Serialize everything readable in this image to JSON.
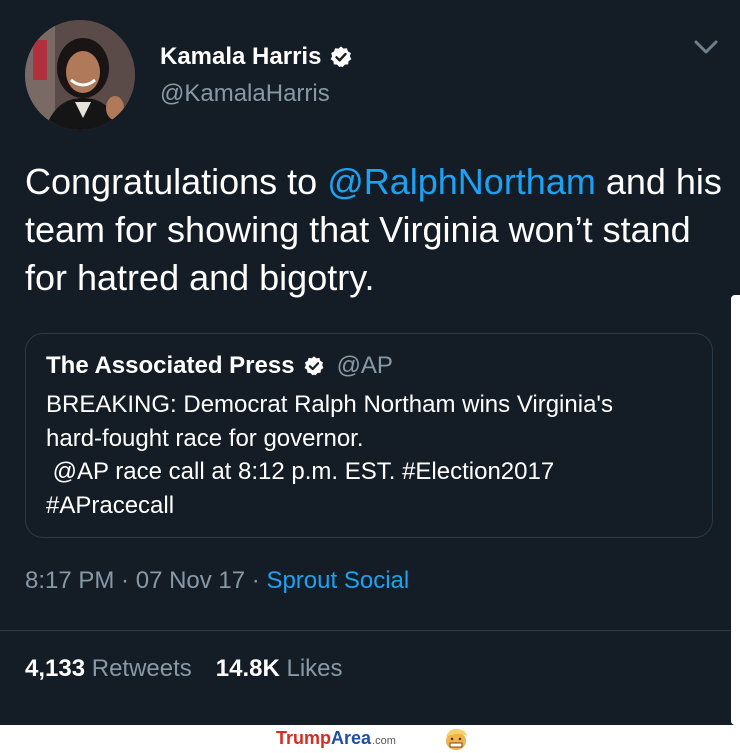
{
  "tweet": {
    "author_name": "Kamala Harris",
    "author_handle": "@KamalaHarris",
    "text_before": "Congratulations to ",
    "mention": "@RalphNortham",
    "text_after": " and his team for showing that Virginia won’t stand for hatred and bigotry.",
    "quote": {
      "name": "The Associated Press",
      "handle": "@AP",
      "lines": [
        "BREAKING: Democrat Ralph Northam wins Virginia's",
        "hard-fought race for governor.",
        " @AP race call at 8:12 p.m. EST. #Election2017",
        "#APracecall"
      ]
    },
    "time": "8:17 PM",
    "date": "07 Nov 17",
    "separator": " · ",
    "source": "Sprout Social",
    "retweets_count": "4,133",
    "retweets_label": "Retweets",
    "likes_count": "14.8K",
    "likes_label": "Likes"
  },
  "watermark": {
    "part1": "Trump",
    "part2": "Area",
    "part3": ".com"
  },
  "icons": {
    "verified": "verified-badge-icon",
    "menu": "chevron-down-icon"
  },
  "colors": {
    "background": "#141d26",
    "link": "#1da1f2",
    "secondary_text": "#8899a6",
    "border": "#2b3a48"
  }
}
